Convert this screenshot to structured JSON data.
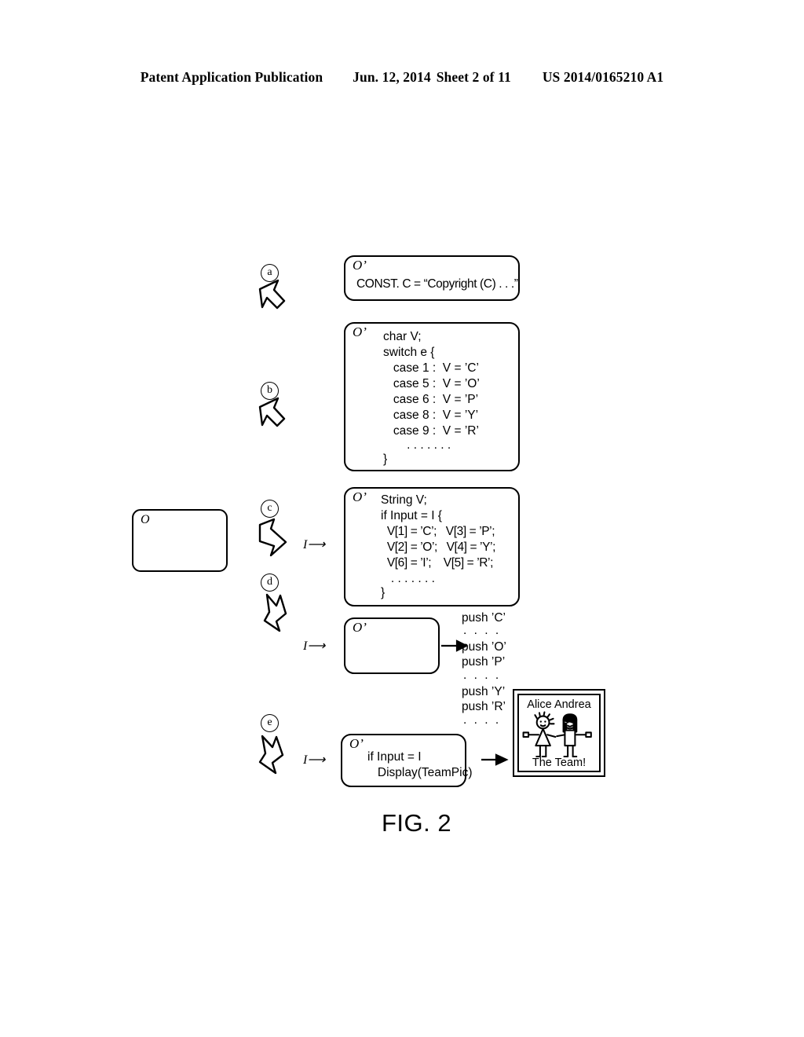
{
  "header": {
    "publication": "Patent Application Publication",
    "date": "Jun. 12, 2014",
    "sheet": "Sheet 2 of 11",
    "patent_number": "US 2014/0165210 A1"
  },
  "figure": {
    "caption": "FIG. 2",
    "object_box": {
      "label": "O"
    },
    "obf_label": "O’",
    "input_marker": "I",
    "steps": [
      {
        "tag": "a"
      },
      {
        "tag": "b"
      },
      {
        "tag": "c"
      },
      {
        "tag": "d"
      },
      {
        "tag": "e"
      }
    ],
    "boxes": [
      {
        "id": "box-a",
        "tag": "a",
        "obf": "O’",
        "lines": [
          "CONST. C = “Copyright (C) . . .”"
        ]
      },
      {
        "id": "box-b",
        "tag": "b",
        "obf": "O’",
        "lines": [
          "char V;",
          "switch e {",
          "   case 1 :  V = ’C’",
          "   case 5 :  V = ’O’",
          "   case 6 :  V = ’P’",
          "   case 8 :  V = ’Y’",
          "   case 9 :  V = ’R’",
          "       . . . . . . .",
          "}"
        ]
      },
      {
        "id": "box-c",
        "tag": "c",
        "obf": "O’",
        "lines": [
          "String V;",
          "if Input = I {",
          "  V[1] = ’C’;   V[3] = ’P’;",
          "  V[2] = ’O’;   V[4] = ’Y’;",
          "  V[6] = ’I’;    V[5] = ’R’;",
          "   . . . . . . .",
          "}"
        ]
      },
      {
        "id": "box-d",
        "tag": "d",
        "obf": "O’",
        "lines": []
      },
      {
        "id": "box-e",
        "tag": "e",
        "obf": "O’",
        "lines": [
          "if Input = I",
          "   Display(TeamPic)"
        ]
      }
    ],
    "push_sequence": [
      "push ’C’",
      ". . . .",
      "push ’O’",
      "push ’P’",
      ". . . .",
      "push ’Y’",
      "push ’R’",
      ". . . ."
    ],
    "team_picture": {
      "names": "Alice Andrea",
      "caption": "The Team!"
    }
  }
}
